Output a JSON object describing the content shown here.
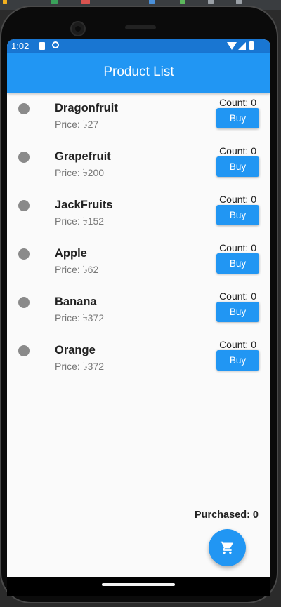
{
  "status_bar": {
    "time": "1:02"
  },
  "app_bar": {
    "title": "Product List"
  },
  "products": [
    {
      "name": "Dragonfruit",
      "price_label": "Price: ",
      "price": "৳27",
      "count_label": "Count: ",
      "count": "0",
      "buy_label": "Buy"
    },
    {
      "name": "Grapefruit",
      "price_label": "Price: ",
      "price": "৳200",
      "count_label": "Count: ",
      "count": "0",
      "buy_label": "Buy"
    },
    {
      "name": "JackFruits",
      "price_label": "Price: ",
      "price": "৳152",
      "count_label": "Count: ",
      "count": "0",
      "buy_label": "Buy"
    },
    {
      "name": "Apple",
      "price_label": "Price: ",
      "price": "৳62",
      "count_label": "Count: ",
      "count": "0",
      "buy_label": "Buy"
    },
    {
      "name": "Banana",
      "price_label": "Price: ",
      "price": "৳372",
      "count_label": "Count: ",
      "count": "0",
      "buy_label": "Buy"
    },
    {
      "name": "Orange",
      "price_label": "Price: ",
      "price": "৳372",
      "count_label": "Count: ",
      "count": "0",
      "buy_label": "Buy"
    }
  ],
  "summary": {
    "purchased_label": "Purchased: ",
    "purchased": "0"
  },
  "fab": {
    "icon": "cart-icon"
  },
  "colors": {
    "primary": "#2196f3",
    "status_bar": "#1976d2",
    "avatar": "#8a8a8a"
  }
}
